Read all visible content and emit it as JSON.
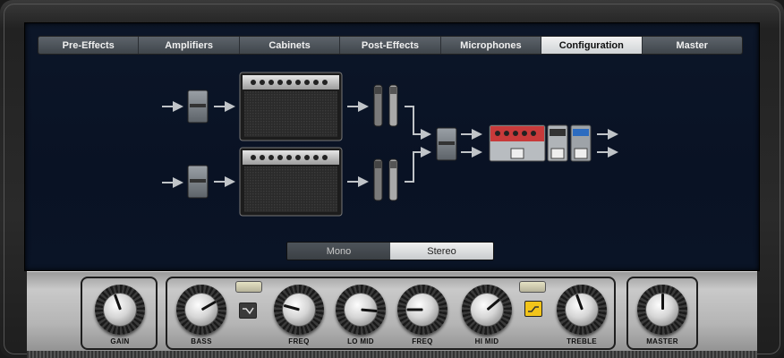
{
  "tabs": [
    "Pre-Effects",
    "Amplifiers",
    "Cabinets",
    "Post-Effects",
    "Microphones",
    "Configuration",
    "Master"
  ],
  "active_tab": "Configuration",
  "mode_toggle": {
    "mono": "Mono",
    "stereo": "Stereo",
    "selected": "Stereo"
  },
  "controls": {
    "gain": "GAIN",
    "bass": "BASS",
    "freq_low": "FREQ",
    "lo_mid": "LO MID",
    "freq_high": "FREQ",
    "hi_mid": "HI MID",
    "treble": "TREBLE",
    "master": "MASTER"
  },
  "colors": {
    "active_tab": "#e8e8e8",
    "screen_bg": "#0b1426",
    "led_off": "#d8d6b8",
    "led_on": "#f2c41a"
  }
}
